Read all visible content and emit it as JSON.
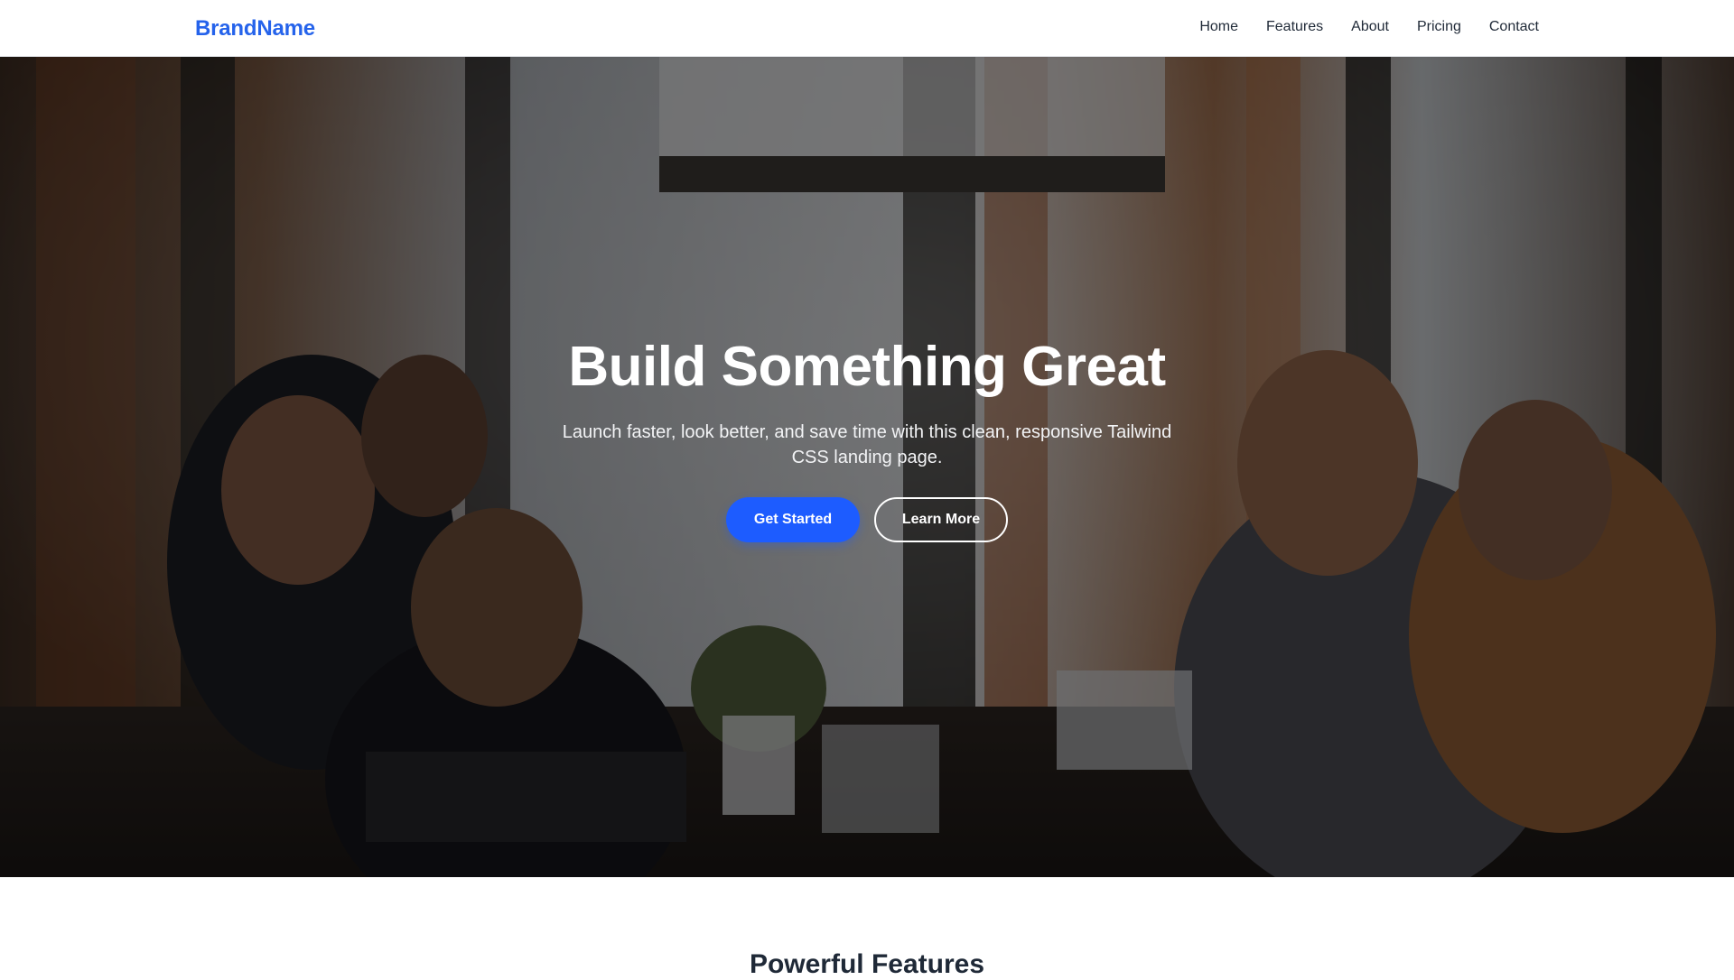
{
  "nav": {
    "brand": "BrandName",
    "links": [
      "Home",
      "Features",
      "About",
      "Pricing",
      "Contact"
    ]
  },
  "hero": {
    "title": "Build Something Great",
    "subtitle": "Launch faster, look better, and save time with this clean, responsive Tailwind CSS landing page.",
    "primary_button": "Get Started",
    "secondary_button": "Learn More"
  },
  "features": {
    "title": "Powerful Features"
  },
  "colors": {
    "brand": "#2563eb",
    "primary_button": "#1d5cff",
    "hero_overlay": "rgba(0,0,0,0.45)"
  }
}
